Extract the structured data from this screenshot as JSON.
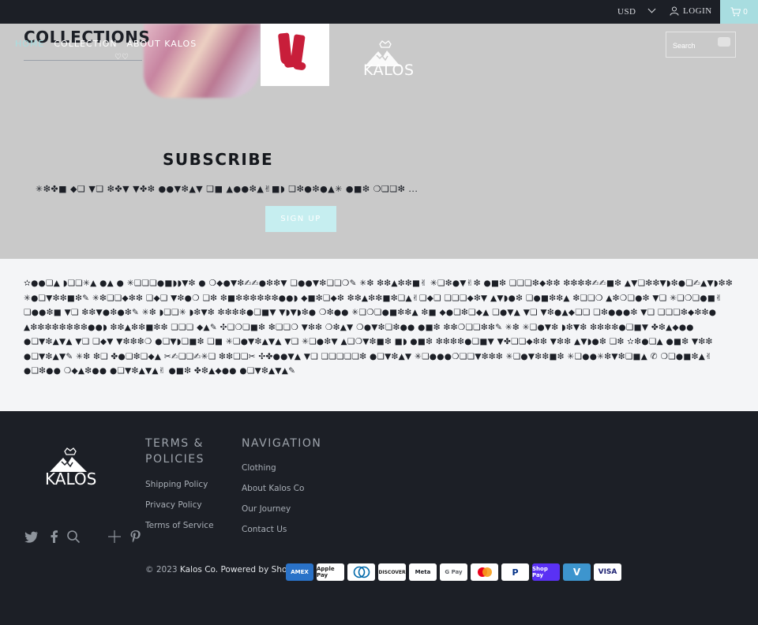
{
  "topbar": {
    "currency": "USD",
    "login_label": "LOGIN",
    "cart_count": "0"
  },
  "header": {
    "page_title": "COLLECTIONS",
    "nav": [
      "HOME",
      "COLLECTION",
      "ABOUT KALOS"
    ],
    "brand": "KALOS",
    "search_placeholder": "Search"
  },
  "subscribe": {
    "heading": "SUBSCRIBE",
    "text": "✳❇✤■ ◆❏ ▼❏ ❇✤▼ ▼✤❇ ●●▼❇▲▼ ❏■ ▲●●❇▲✌■◗ ❏❇●❇●▲✳ ●■❇ ❍❏❏❇ ...",
    "button_label": "SIGN UP"
  },
  "info": {
    "text": "✫●●❏▲ ◗❏❏✳▲ ●▲ ● ✳❏❏❏●■◗◗▼❇ ● ❍◆●▼❇✍✍●❇❇▼ ❏●●▼❇❏❏❍✎ ✳❇ ❇❇▲❇❇■✌ ✳❏❇●▼✌❇ ●■❇ ❏❏❏❇◆❇❇ ❇❇❇❇✍✍■❇ ▲▼❏❇❇▼◗❇●❏✍▲▼◗❇❇ ✳●❏▼❇❇■❇✎ ✳❇❏❏◆❇❇ ❏◆❏ ▼❇●❍ ❏❇ ❇■❇❇❇❇❇❇●●◗ ◆■❇❏◆❇ ❇❇▲❇❇■❇❏▲✌❏◆❏ ❏❏❏◆❇▼ ▲▼◗●❇ ❏●■❇❇▲ ❇❏❏❍ ▲❇❍❏●❇ ▼❏ ✳❏❍❏●■✌❏●●❇■ ▼❏ ❇❇▼●❇●❇✎ ✳❇ ◗❏❏✳ ◗❇▼❇ ❇❇❇❇●❏■▼ ▼◗▼◗❇● ❍❇●● ✳❏❍❏●■❇❇▲ ❇■ ◆●❏❇❏◆▲ ❏●▼▲ ▼❏ ▼❇●▲◆❏❏ ❏❇●●●❇ ▼❏ ❏❏❏❇◆❇❇● ▲❇❇❇❇❇❇❇❇●●◗ ❇❇▲❇❇■❇❇ ❏❏❏ ◆▲✎ ✣❏❍❏■❇ ❇❏❏❍ ▼❇❇ ❍❇▲▼ ❍●▼❇❏❇●● ●■❇ ❇❇❍❏❏❇❇✎ ✳❇ ✳❏●▼❇ ◗❇▼❇ ❇❇❇❇●❏■▼ ✤❇▲◆●● ●❏▼❇▲▼▲ ▼❏ ❏◆▼ ▼❇❇❇❍ ●❏▼◗❏■❇ ❏■ ✳❏●▼❇▲▼▲ ▼❏ ✳❏●❇▼ ▲❏❍▼❇■❇ ■◗ ●■❇ ❇❇❇❇●❏■▼ ▼✤❏❏◆❇❇ ▼❇❇ ▲▼◗●❇ ❏❇ ✫❇●❏▲ ●■❇ ▼❇❇ ●❏▼❇▲▼✎ ✳❇ ❇❏ ✤●❏❇❏◆▲ ✂✍❏❏✍✳❏ ❇❇❏❏✂ ✣✤●●▼▲ ▼❏ ❏❏❏❏❏❇ ●❏▼❇▲▼ ✳❏●●●❍❏❏▼❇❇❇ ✳❏●▼❇❇■❇ ✳❏●●✳❇▼❇❏■▲ ✆ ❍❏●■❇▲✌●❏❇●● ❍◆▲❇●● ●❏▼❇▲▼▲✌ ●■❇ ✤❇▲◆●● ●❏▼❇▲▼▲✎"
  },
  "footer": {
    "brand": "KALOS",
    "terms_title": "TERMS & POLICIES",
    "terms_links": [
      "Shipping Policy",
      "Privacy Policy",
      "Terms of Service"
    ],
    "nav_title": "NAVIGATION",
    "nav_links": [
      "Clothing",
      "About Kalos Co",
      "Our Journey",
      "Contact Us"
    ],
    "copyright_prefix": "© 2023",
    "copyright_brand": "Kalos Co.",
    "powered_by": "Powered by Shopify",
    "payment_methods": [
      "AMEX",
      "Apple Pay",
      "Diners Club",
      "DISCOVER",
      "Meta",
      "G Pay",
      "Mastercard",
      "PayPal",
      "Shop Pay",
      "Venmo",
      "VISA"
    ],
    "social_icons": [
      "twitter-icon",
      "facebook-icon",
      "search-icon",
      "plus-icon",
      "pinterest-icon"
    ]
  },
  "colors": {
    "dark": "#1c1f26",
    "accent": "#a8dde0",
    "hero_bg": "#c9c9c9",
    "info_bg": "#f4f5f7"
  }
}
